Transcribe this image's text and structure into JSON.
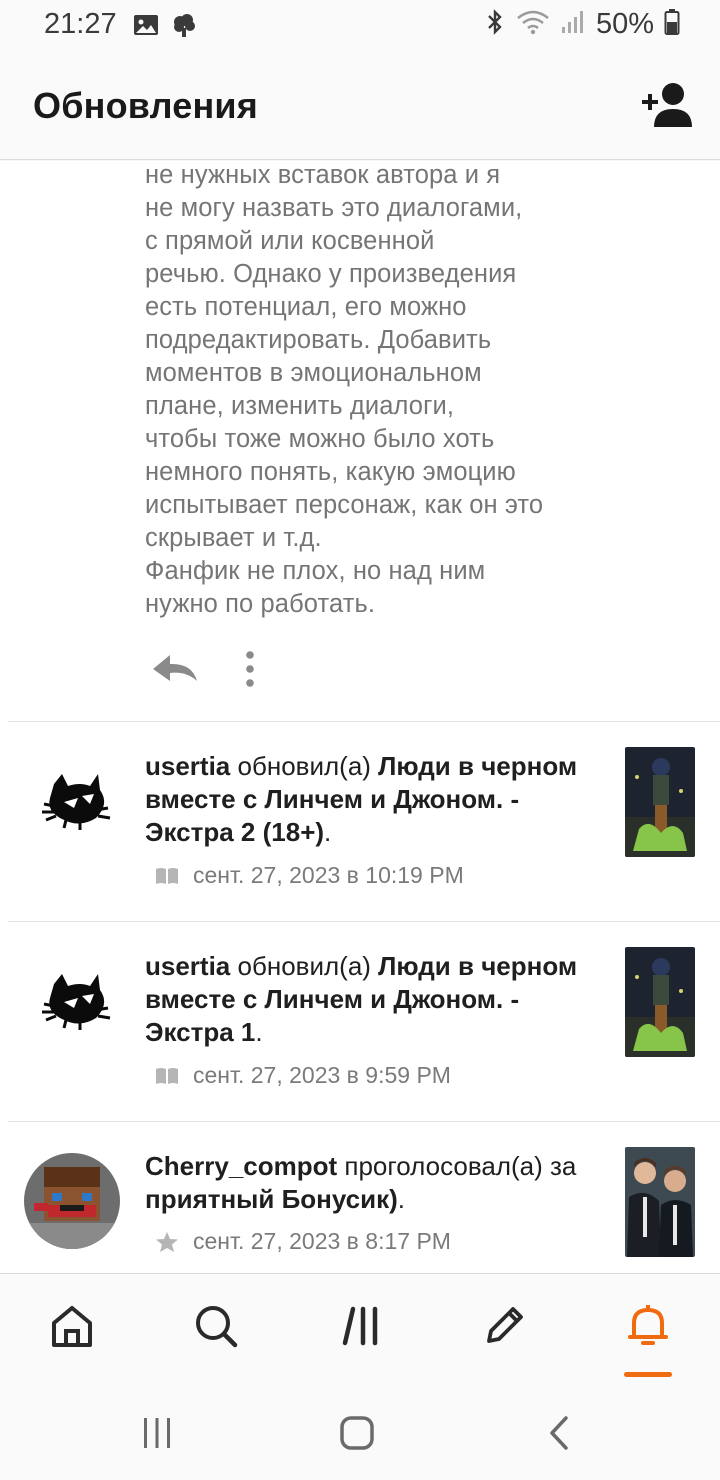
{
  "status_bar": {
    "time": "21:27",
    "battery": "50%",
    "icons": [
      "image-icon",
      "cloud-icon",
      "bluetooth-icon",
      "wifi-icon",
      "signal-icon",
      "battery-icon"
    ]
  },
  "app_bar": {
    "title": "Обновления",
    "add_user_icon": "add-user-icon"
  },
  "comment": {
    "text": "не нужных вставок автора и я\nне могу назвать это диалогами,\nс прямой или косвенной\nречью. Однако у произведения\nесть потенциал, его можно\nподредактировать. Добавить\nмоментов в эмоциональном\nплане, изменить диалоги,\nчтобы тоже можно было хоть\nнемного понять, какую эмоцию\nиспытывает персонаж, как он это\nскрывает и т.д.\nФанфик не плох, но над ним\nнужно по работать.",
    "reply_icon": "reply-icon",
    "more_icon": "more-vertical-icon"
  },
  "feed": [
    {
      "user": "usertia",
      "action": " обновил(а) ",
      "title": "Люди в черном вместе с Линчем и Джоном. - Экстра 2 (18+)",
      "suffix": ".",
      "date": "сент. 27, 2023 в 10:19 PM",
      "meta_icon": "book-icon"
    },
    {
      "user": "usertia",
      "action": " обновил(а) ",
      "title": "Люди в черном вместе с Линчем и Джоном. - Экстра 1",
      "suffix": ".",
      "date": "сент. 27, 2023 в 9:59 PM",
      "meta_icon": "book-icon"
    },
    {
      "user": "Cherry_compot",
      "action": " проголосовал(а) за ",
      "title": "приятный Бонусик)",
      "suffix": ".",
      "date": "сент. 27, 2023 в 8:17 PM",
      "meta_icon": "star-icon"
    }
  ],
  "bottom_nav": {
    "items": [
      "home-icon",
      "search-icon",
      "library-icon",
      "write-icon",
      "notifications-icon"
    ],
    "active": "notifications-icon",
    "accent": "#f06a0f"
  },
  "system_nav": {
    "items": [
      "recents-icon",
      "home-circle-icon",
      "back-icon"
    ]
  }
}
